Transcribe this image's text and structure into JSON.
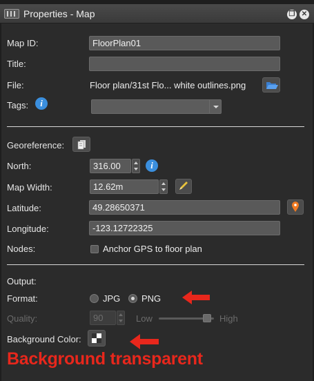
{
  "window": {
    "title": "Properties - Map",
    "restore_icon": "restore-window-icon",
    "close_icon": "close-window-icon"
  },
  "map_id": {
    "label": "Map ID:",
    "value": "FloorPlan01"
  },
  "title_field": {
    "label": "Title:",
    "value": ""
  },
  "file": {
    "label": "File:",
    "value": "Floor plan/31st Flo... white outlines.png",
    "button_icon": "folder-open-icon"
  },
  "tags": {
    "label": "Tags:",
    "value": "",
    "info_icon": "info-icon"
  },
  "georeference": {
    "label": "Georeference:",
    "button_icon": "document-copy-icon"
  },
  "north": {
    "label": "North:",
    "value": "316.00"
  },
  "map_width": {
    "label": "Map Width:",
    "value": "12.62m",
    "button_icon": "pencil-ruler-icon"
  },
  "latitude": {
    "label": "Latitude:",
    "value": "49.28650371",
    "button_icon": "map-pin-icon"
  },
  "longitude": {
    "label": "Longitude:",
    "value": "-123.12722325"
  },
  "nodes": {
    "label": "Nodes:",
    "checkbox_label": "Anchor GPS to floor plan",
    "checked": false
  },
  "output": {
    "label": "Output:",
    "format_label": "Format:",
    "formats": [
      "JPG",
      "PNG"
    ],
    "selected_format": "PNG",
    "quality_label": "Quality:",
    "quality_value": "90",
    "quality_low": "Low",
    "quality_high": "High",
    "quality_level": 0.88,
    "background_color_label": "Background Color:"
  },
  "annotation": {
    "text": "Background transparent",
    "color": "#e8271c"
  },
  "colors": {
    "panel": "#2b2b2b",
    "field": "#595959",
    "accent_info": "#3b8fde",
    "annotation": "#e8271c"
  }
}
